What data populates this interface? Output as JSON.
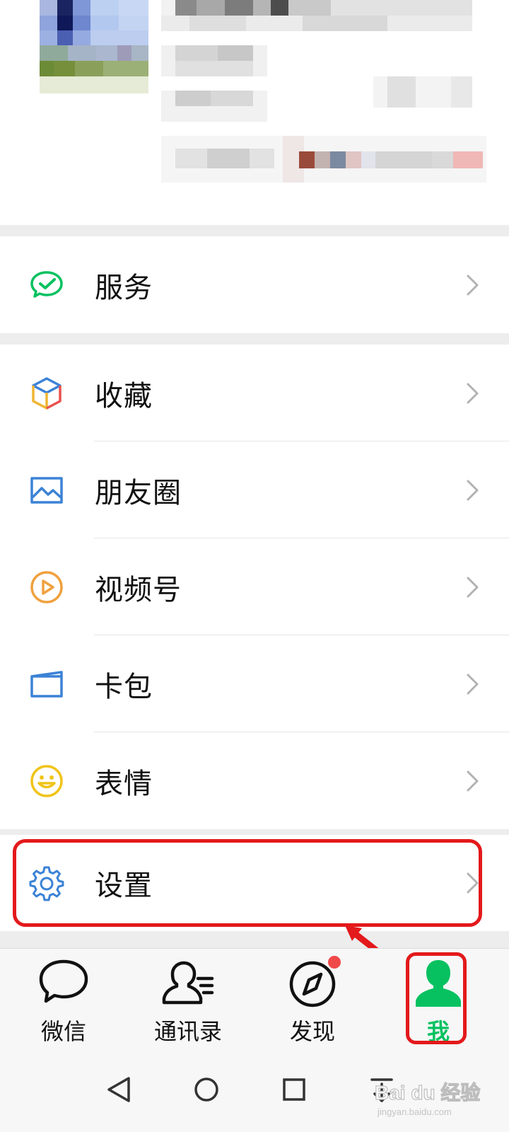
{
  "menu": {
    "service": {
      "label": "服务",
      "icon": "wechat-pay-icon"
    },
    "favorites": {
      "label": "收藏",
      "icon": "cube-icon"
    },
    "moments": {
      "label": "朋友圈",
      "icon": "picture-icon"
    },
    "channels": {
      "label": "视频号",
      "icon": "play-icon"
    },
    "cards": {
      "label": "卡包",
      "icon": "card-wallet-icon"
    },
    "stickers": {
      "label": "表情",
      "icon": "smiley-icon"
    },
    "settings": {
      "label": "设置",
      "icon": "gear-icon"
    }
  },
  "tabbar": {
    "tabs": [
      {
        "label": "微信",
        "icon": "chat-bubble-icon"
      },
      {
        "label": "通讯录",
        "icon": "contacts-icon"
      },
      {
        "label": "发现",
        "icon": "compass-icon"
      },
      {
        "label": "我",
        "icon": "person-icon"
      }
    ],
    "active": "我"
  },
  "colors": {
    "accent": "#07c160",
    "highlight": "#e3191b",
    "badge": "#f04949"
  },
  "watermark": {
    "text": "Bai du 经验",
    "subtext": "jingyan.baidu.com"
  }
}
